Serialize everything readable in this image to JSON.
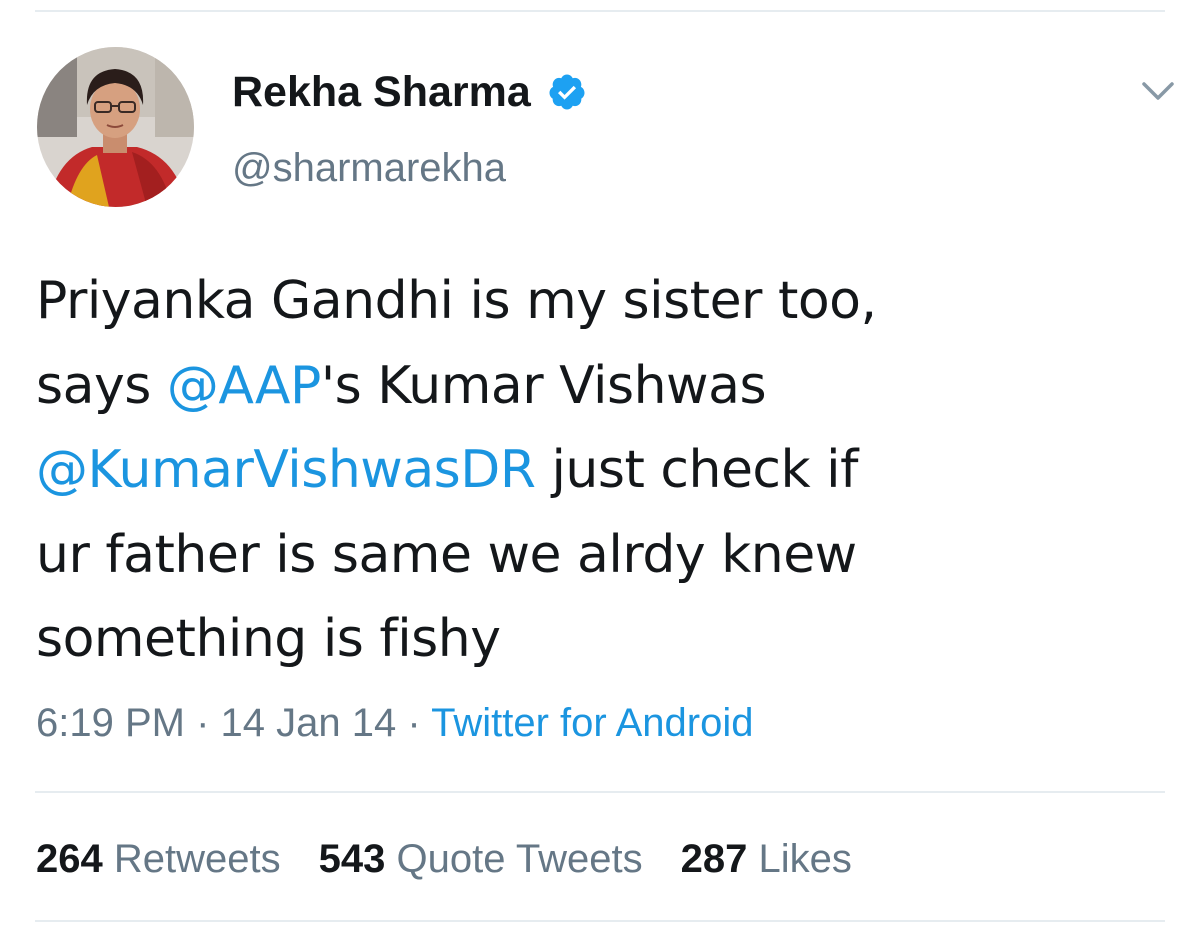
{
  "author": {
    "display_name": "Rekha Sharma",
    "handle": "@sharmarekha",
    "verified": true
  },
  "icons": {
    "verified": "verified-badge-icon",
    "menu": "chevron-down-icon",
    "verified_color": "#1da1f2"
  },
  "tweet": {
    "segments": [
      {
        "text": "Priyanka Gandhi is my sister too,"
      },
      {
        "text": "says "
      },
      {
        "text": "@AAP",
        "mention": true
      },
      {
        "text": "'s Kumar Vishwas"
      },
      {
        "text": "@KumarVishwasDR",
        "mention": true
      },
      {
        "text": " just check if"
      },
      {
        "text": "ur father is same we alrdy knew"
      },
      {
        "text": "something is fishy"
      }
    ]
  },
  "meta": {
    "time": "6:19 PM",
    "separator": "·",
    "date": "14 Jan 14",
    "source": "Twitter for Android"
  },
  "stats": {
    "retweets_count": "264",
    "retweets_label": "Retweets",
    "quotes_count": "543",
    "quotes_label": "Quote Tweets",
    "likes_count": "287",
    "likes_label": "Likes"
  },
  "colors": {
    "link": "#1b95e0",
    "text": "#14171a",
    "secondary": "#657786",
    "divider": "#e6ecf0"
  }
}
